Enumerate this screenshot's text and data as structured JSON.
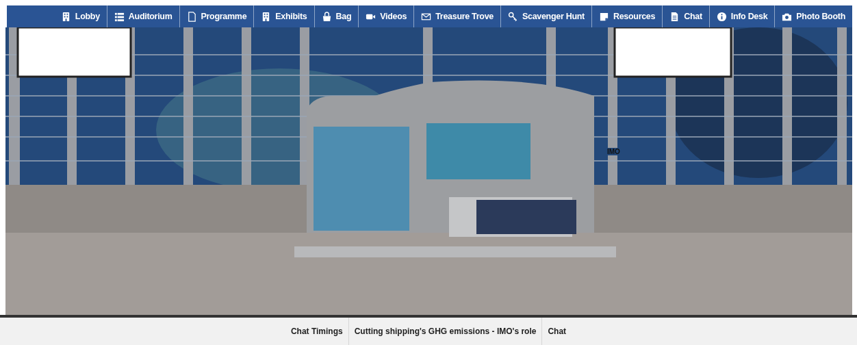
{
  "nav": [
    {
      "label": "Lobby"
    },
    {
      "label": "Auditorium"
    },
    {
      "label": "Programme"
    },
    {
      "label": "Exhibits"
    },
    {
      "label": "Bag"
    },
    {
      "label": "Videos"
    },
    {
      "label": "Treasure Trove"
    },
    {
      "label": "Scavenger Hunt"
    },
    {
      "label": "Resources"
    },
    {
      "label": "Chat"
    },
    {
      "label": "Info Desk"
    },
    {
      "label": "Photo Booth"
    }
  ],
  "booth_label": "IMO",
  "bottom_tabs": [
    "Chat Timings",
    "Cutting shipping's GHG emissions - IMO's role",
    "Chat"
  ]
}
